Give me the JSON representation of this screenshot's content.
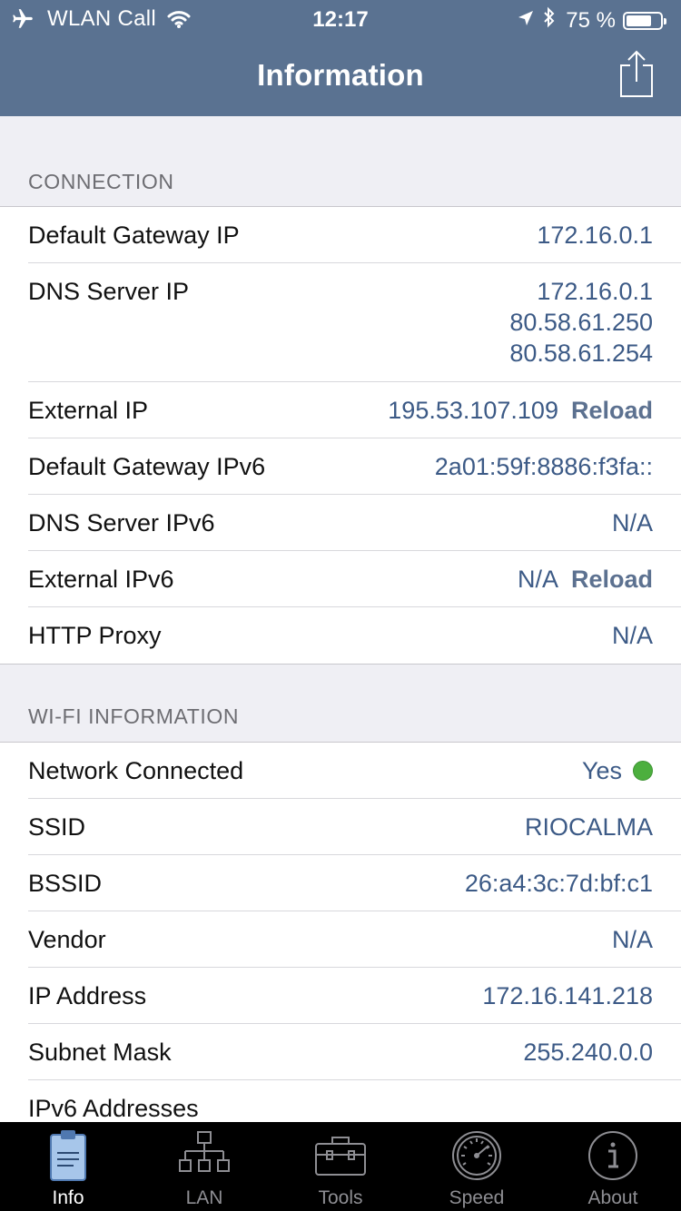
{
  "status_bar": {
    "carrier": "WLAN Call",
    "time": "12:17",
    "battery_percent": "75 %",
    "battery_level": 0.75
  },
  "nav": {
    "title": "Information",
    "share_icon": "share-icon"
  },
  "sections": {
    "connection": {
      "title": "CONNECTION",
      "rows": {
        "gateway": {
          "label": "Default Gateway IP",
          "value": "172.16.0.1"
        },
        "dns": {
          "label": "DNS Server IP",
          "values": [
            "172.16.0.1",
            "80.58.61.250",
            "80.58.61.254"
          ]
        },
        "external_ip": {
          "label": "External IP",
          "value": "195.53.107.109",
          "action": "Reload"
        },
        "gateway_v6": {
          "label": "Default Gateway IPv6",
          "value": "2a01:59f:8886:f3fa::"
        },
        "dns_v6": {
          "label": "DNS Server IPv6",
          "value": "N/A"
        },
        "external_v6": {
          "label": "External IPv6",
          "value": "N/A",
          "action": "Reload"
        },
        "proxy": {
          "label": "HTTP Proxy",
          "value": "N/A"
        }
      }
    },
    "wifi": {
      "title": "WI-FI INFORMATION",
      "rows": {
        "connected": {
          "label": "Network Connected",
          "value": "Yes",
          "status_color": "#4caf3e"
        },
        "ssid": {
          "label": "SSID",
          "value": "RIOCALMA"
        },
        "bssid": {
          "label": "BSSID",
          "value": "26:a4:3c:7d:bf:c1"
        },
        "vendor": {
          "label": "Vendor",
          "value": "N/A"
        },
        "ip": {
          "label": "IP Address",
          "value": "172.16.141.218"
        },
        "subnet": {
          "label": "Subnet Mask",
          "value": "255.240.0.0"
        },
        "ipv6": {
          "label": "IPv6 Addresses",
          "value": ""
        }
      }
    }
  },
  "tabbar": {
    "tabs": [
      {
        "label": "Info",
        "icon": "clipboard-icon",
        "active": true
      },
      {
        "label": "LAN",
        "icon": "network-tree-icon",
        "active": false
      },
      {
        "label": "Tools",
        "icon": "toolbox-icon",
        "active": false
      },
      {
        "label": "Speed",
        "icon": "speedometer-icon",
        "active": false
      },
      {
        "label": "About",
        "icon": "info-circle-icon",
        "active": false
      }
    ]
  },
  "colors": {
    "nav_background": "#5a7291",
    "value_text": "#3c5a86",
    "tab_active": "#ffffff",
    "tab_inactive": "#8e8e93"
  }
}
